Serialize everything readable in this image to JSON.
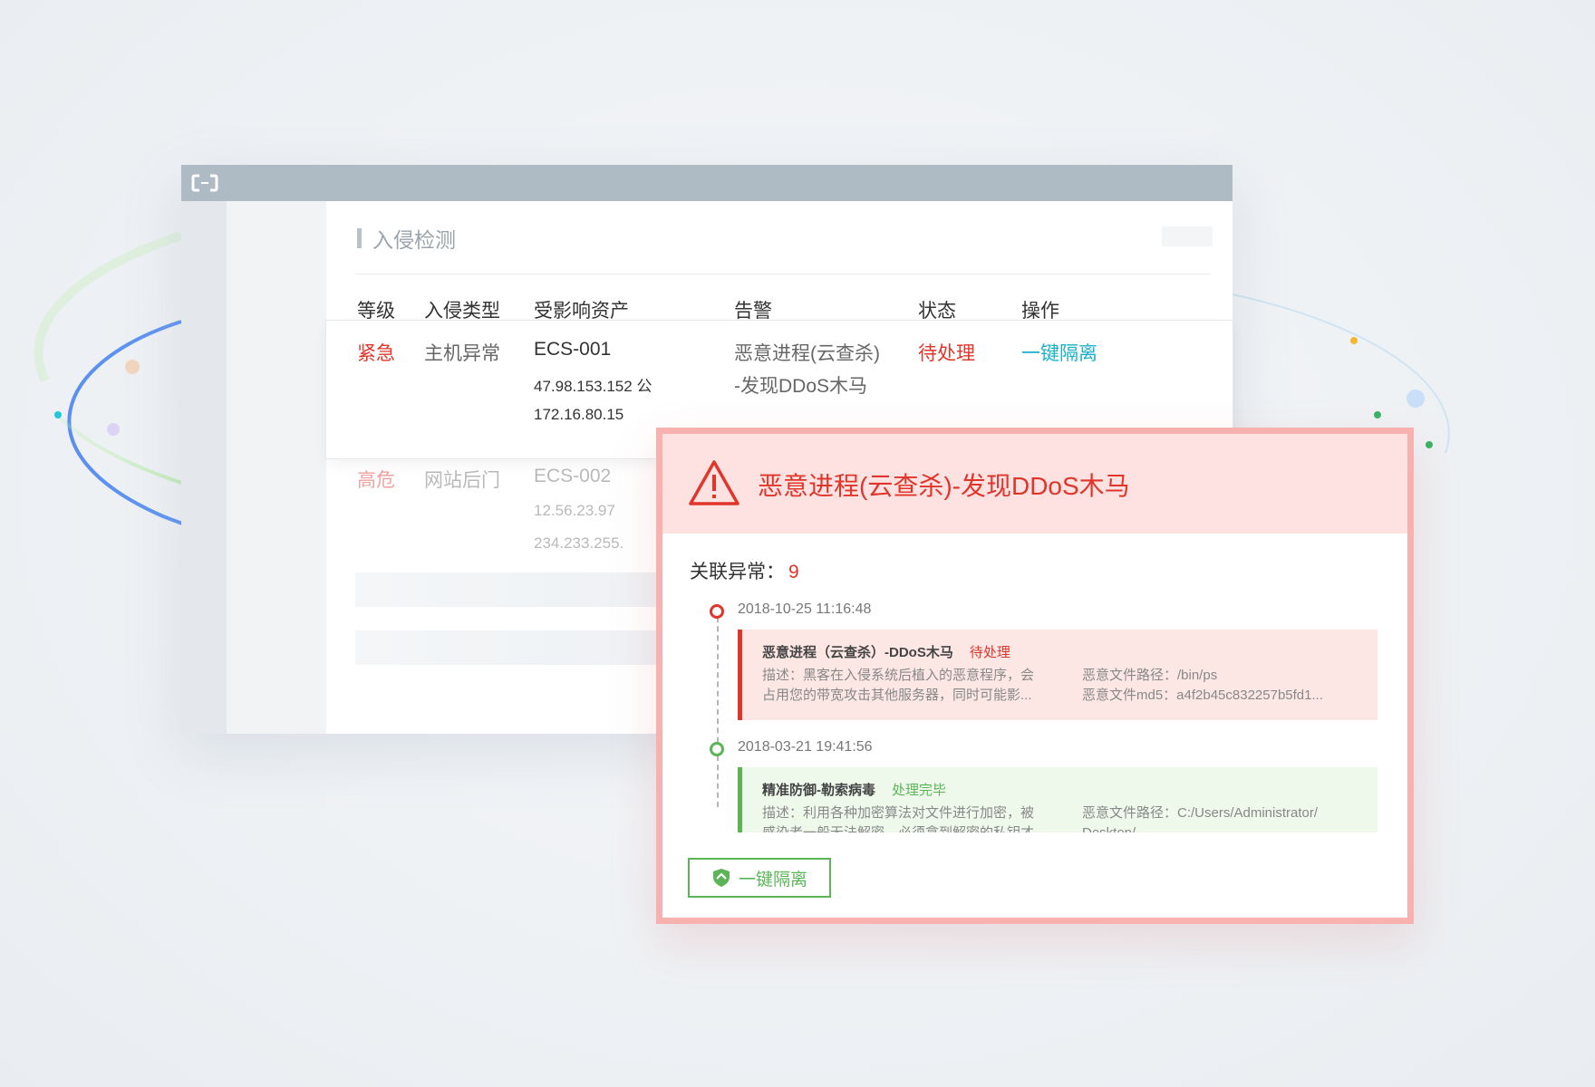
{
  "console": {
    "section_title": "入侵检测",
    "columns": [
      "等级",
      "入侵类型",
      "受影响资产",
      "告警",
      "状态",
      "操作"
    ],
    "rows": [
      {
        "level": "紧急",
        "type": "主机异常",
        "asset": "ECS-001",
        "ip1": "47.98.153.152 公",
        "ip2": "172.16.80.15",
        "alert_line1": "恶意进程(云查杀)",
        "alert_line2": "-发现DDoS木马",
        "status": "待处理",
        "action": "一键隔离"
      },
      {
        "level": "高危",
        "type": "网站后门",
        "asset": "ECS-002",
        "ip1": "12.56.23.97",
        "ip2": "234.233.255."
      }
    ]
  },
  "popup": {
    "title": "恶意进程(云查杀)-发现DDoS木马",
    "assoc_label": "关联异常：",
    "assoc_count": "9",
    "events": [
      {
        "time": "2018-10-25 11:16:48",
        "name": "恶意进程（云查杀）-DDoS木马",
        "status": "待处理",
        "desc_line1": "描述：黑客在入侵系统后植入的恶意程序，会",
        "desc_line2": "占用您的带宽攻击其他服务器，同时可能影...",
        "path_line1": "恶意文件路径：/bin/ps",
        "path_line2": "恶意文件md5：a4f2b45c832257b5fd1..."
      },
      {
        "time": "2018-03-21 19:41:56",
        "name": "精准防御-勒索病毒",
        "status": "处理完毕",
        "desc_line1": "描述：利用各种加密算法对文件进行加密，被",
        "desc_line2": "感染者一般无法解密，必须拿到解密的私钥才",
        "path_line1": "恶意文件路径：C:/Users/Administrator/",
        "path_line2": "Desktop/"
      }
    ],
    "isolate_button": "一键隔离"
  },
  "colors": {
    "danger": "#e0352b",
    "success": "#5bb557",
    "action": "#1ab0c8",
    "titlebar": "#aebbc5"
  }
}
